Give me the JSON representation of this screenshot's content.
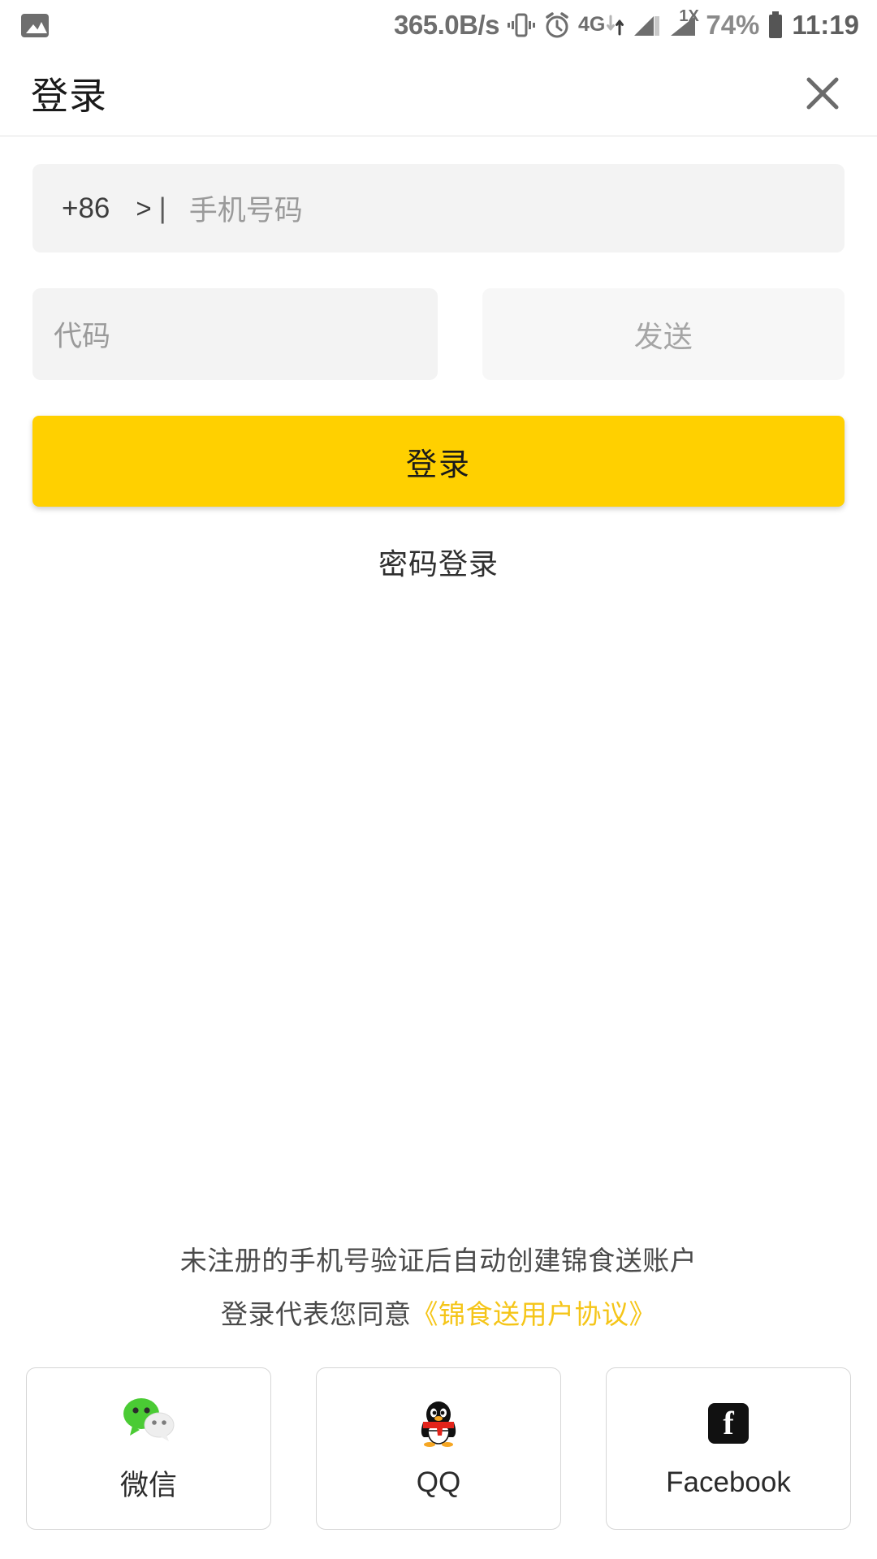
{
  "status_bar": {
    "gallery_icon": "gallery-icon",
    "network_speed": "365.0B/s",
    "vibrate_icon": "vibrate-icon",
    "alarm_icon": "alarm-clock-icon",
    "data_type": "4G",
    "signal_label_2": "1X",
    "battery_percent": "74%",
    "battery_icon": "battery-icon",
    "clock": "11:19"
  },
  "app_bar": {
    "title": "登录",
    "close_icon": "close-icon"
  },
  "form": {
    "country_code": "+86",
    "country_caret": ">",
    "separator": "|",
    "phone_placeholder": "手机号码",
    "phone_value": "",
    "code_placeholder": "代码",
    "code_value": "",
    "send_label": "发送",
    "login_label": "登录",
    "password_login_label": "密码登录"
  },
  "footer": {
    "agreement_line1": "未注册的手机号验证后自动创建锦食送账户",
    "agreement_line2_prefix": "登录代表您同意",
    "agreement_link": "《锦食送用户协议》",
    "socials": [
      {
        "label": "微信",
        "icon": "wechat-icon"
      },
      {
        "label": "QQ",
        "icon": "qq-penguin-icon"
      },
      {
        "label": "Facebook",
        "icon": "facebook-icon"
      }
    ]
  },
  "colors": {
    "accent_yellow": "#FFD000",
    "link_yellow": "#F5C518",
    "field_gray": "#f3f3f3",
    "wechat_green": "#4ACB34",
    "qq_red": "#E2231A"
  }
}
